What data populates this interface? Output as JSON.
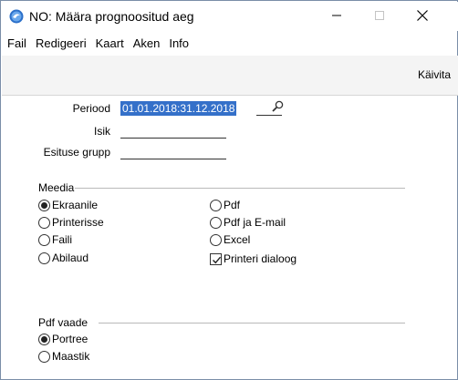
{
  "window": {
    "title": "NO: Määra prognoositud aeg"
  },
  "menu": {
    "items": [
      "Fail",
      "Redigeeri",
      "Kaart",
      "Aken",
      "Info"
    ]
  },
  "toolbar": {
    "run_label": "Käivita"
  },
  "fields": {
    "periood": {
      "label": "Periood",
      "value": "01.01.2018:31.12.2018"
    },
    "isik": {
      "label": "Isik",
      "value": ""
    },
    "esituse_grupp": {
      "label": "Esituse grupp",
      "value": ""
    }
  },
  "media": {
    "label": "Meedia",
    "options": [
      {
        "label": "Ekraanile",
        "checked": true
      },
      {
        "label": "Printerisse",
        "checked": false
      },
      {
        "label": "Faili",
        "checked": false
      },
      {
        "label": "Abilaud",
        "checked": false
      },
      {
        "label": "Pdf",
        "checked": false
      },
      {
        "label": "Pdf ja E-mail",
        "checked": false
      },
      {
        "label": "Excel",
        "checked": false
      }
    ],
    "printer_dialog": {
      "label": "Printeri dialoog",
      "checked": true
    }
  },
  "pdf_view": {
    "label": "Pdf vaade",
    "options": [
      {
        "label": "Portree",
        "checked": true
      },
      {
        "label": "Maastik",
        "checked": false
      }
    ]
  }
}
